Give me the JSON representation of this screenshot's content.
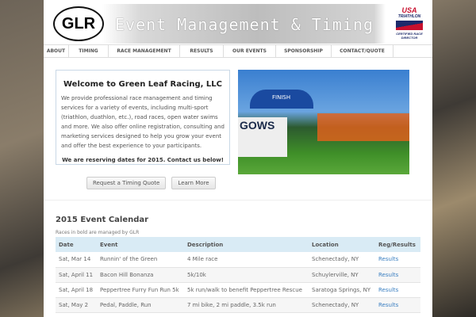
{
  "header": {
    "logo": "GLR",
    "tagline": "Event Management & Timing",
    "badge": {
      "top": "USA",
      "mid": "TRIATHLON",
      "bottom": "CERTIFIED RACE DIRECTOR"
    }
  },
  "nav": [
    "ABOUT",
    "TIMING",
    "RACE MANAGEMENT",
    "RESULTS",
    "OUR EVENTS",
    "SPONSORSHIP",
    "CONTACT/QUOTE"
  ],
  "welcome": {
    "title": "Welcome to Green Leaf Racing, LLC",
    "body": "We provide professional race management and timing services for a variety of events, including multi-sport (triathlon, duathlon, etc.), road races, open water swims and more. We also offer online registration, consulting and marketing services designed to help you grow your event and offer the best experience to your participants.",
    "cta": "We are reserving dates for 2015. Contact us below!"
  },
  "photo": {
    "sign": "GOWS",
    "arch": "FINISH"
  },
  "buttons": {
    "quote": "Request a Timing Quote",
    "learn": "Learn More"
  },
  "calendar": {
    "title": "2015 Event Calendar",
    "note": "Races in bold are managed by GLR",
    "headers": [
      "Date",
      "Event",
      "Description",
      "Location",
      "Reg/Results"
    ],
    "rows": [
      [
        "Sat, Mar 14",
        "Runnin' of the Green",
        "4 Mile race",
        "Schenectady, NY",
        "Results"
      ],
      [
        "Sat, April 11",
        "Bacon Hill Bonanza",
        "5k/10k",
        "Schuylerville, NY",
        "Results"
      ],
      [
        "Sat, April 18",
        "Peppertree Furry Fun Run 5k",
        "5k run/walk to benefit Peppertree Rescue",
        "Saratoga Springs, NY",
        "Results"
      ],
      [
        "Sat, May 2",
        "Pedal, Paddle, Run",
        "7 mi bike, 2 mi paddle, 3.5k run",
        "Schenectady, NY",
        "Results"
      ]
    ]
  }
}
